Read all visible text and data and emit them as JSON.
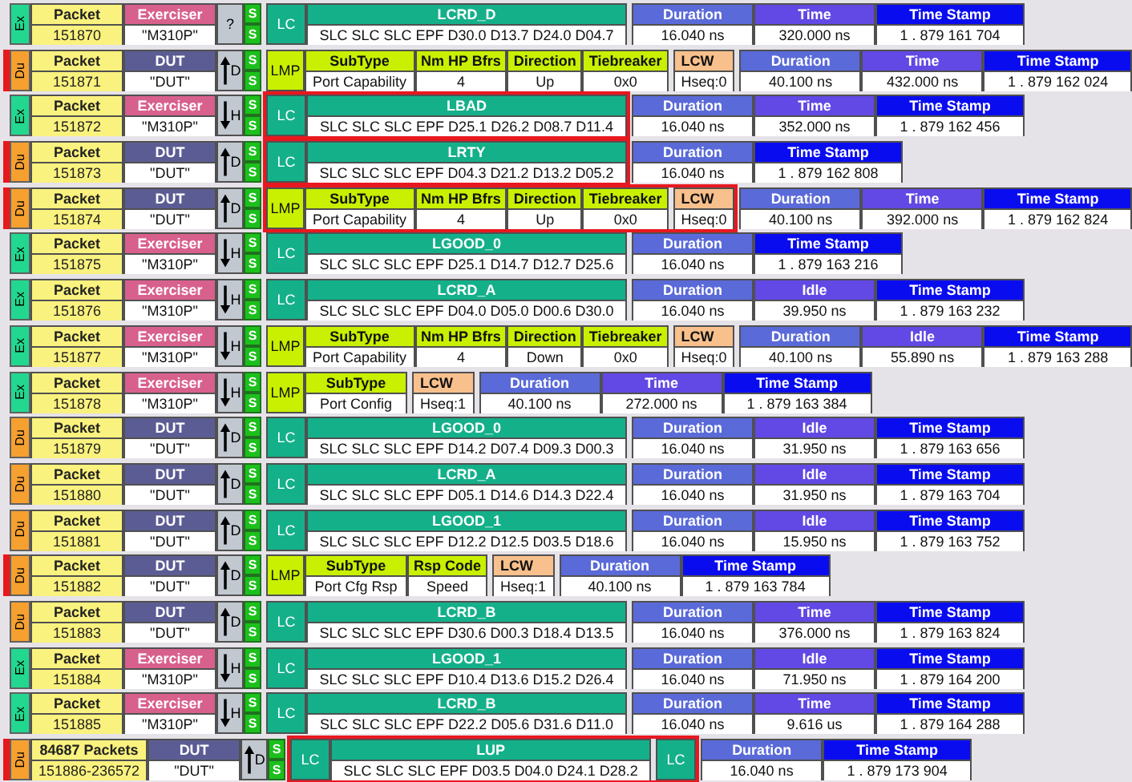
{
  "rows": [
    {
      "side": "Ex",
      "marked": false,
      "packet": {
        "label": "Packet",
        "number": "151870"
      },
      "source": {
        "kind": "exerciser",
        "label": "Exerciser",
        "value": "\"M310P\""
      },
      "arrow_shown": false,
      "link": "?",
      "s": [
        "S",
        "S"
      ],
      "block": {
        "kind": "lc",
        "tag": "LC",
        "name": "LCRD_D",
        "symbols": "SLC SLC SLC EPF D30.0 D13.7 D24.0 D04.7",
        "highlighted": false
      },
      "metrics": [
        {
          "kind": "duration",
          "label": "Duration",
          "value": "16.040 ns"
        },
        {
          "kind": "time",
          "label": "Time",
          "value": "320.000 ns"
        },
        {
          "kind": "timestamp",
          "label": "Time Stamp",
          "value": "1 . 879 161 704"
        }
      ]
    },
    {
      "side": "Du",
      "marked": true,
      "packet": {
        "label": "Packet",
        "number": "151871"
      },
      "source": {
        "kind": "dut",
        "label": "DUT",
        "value": "\"DUT\""
      },
      "arrow_shown": true,
      "upward": true,
      "link": "D",
      "s": [
        "S",
        "S"
      ],
      "block": {
        "kind": "lmp",
        "tag": "LMP",
        "fields": [
          {
            "label": "SubType",
            "value": "Port Capability"
          },
          {
            "label": "Nm HP Bfrs",
            "value": "4"
          },
          {
            "label": "Direction",
            "value": "Up"
          },
          {
            "label": "Tiebreaker",
            "value": "0x0"
          }
        ],
        "lcw": {
          "label": "LCW",
          "value": "Hseq:0"
        },
        "highlighted": false
      },
      "metrics": [
        {
          "kind": "duration",
          "label": "Duration",
          "value": "40.100 ns"
        },
        {
          "kind": "time",
          "label": "Time",
          "value": "432.000 ns"
        },
        {
          "kind": "timestamp",
          "label": "Time Stamp",
          "value": "1 . 879 162 024"
        }
      ]
    },
    {
      "side": "Ex",
      "marked": false,
      "packet": {
        "label": "Packet",
        "number": "151872"
      },
      "source": {
        "kind": "exerciser",
        "label": "Exerciser",
        "value": "\"M310P\""
      },
      "arrow_shown": true,
      "upward": false,
      "link": "H",
      "s": [
        "S",
        "S"
      ],
      "block": {
        "kind": "lc",
        "tag": "LC",
        "name": "LBAD",
        "symbols": "SLC SLC SLC EPF D25.1 D26.2 D08.7 D11.4",
        "highlighted": true
      },
      "metrics": [
        {
          "kind": "duration",
          "label": "Duration",
          "value": "16.040 ns"
        },
        {
          "kind": "time",
          "label": "Time",
          "value": "352.000 ns"
        },
        {
          "kind": "timestamp",
          "label": "Time Stamp",
          "value": "1 . 879 162 456"
        }
      ]
    },
    {
      "side": "Du",
      "marked": true,
      "packet": {
        "label": "Packet",
        "number": "151873"
      },
      "source": {
        "kind": "dut",
        "label": "DUT",
        "value": "\"DUT\""
      },
      "arrow_shown": true,
      "upward": true,
      "link": "D",
      "s": [
        "S",
        "S"
      ],
      "block": {
        "kind": "lc",
        "tag": "LC",
        "name": "LRTY",
        "symbols": "SLC SLC SLC EPF D04.3 D21.2 D13.2 D05.2",
        "highlighted": true
      },
      "metrics": [
        {
          "kind": "duration",
          "label": "Duration",
          "value": "16.040 ns"
        },
        {
          "kind": "timestamp",
          "label": "Time Stamp",
          "value": "1 . 879 162 808"
        }
      ]
    },
    {
      "side": "Du",
      "marked": true,
      "packet": {
        "label": "Packet",
        "number": "151874"
      },
      "source": {
        "kind": "dut",
        "label": "DUT",
        "value": "\"DUT\""
      },
      "arrow_shown": true,
      "upward": true,
      "link": "D",
      "s": [
        "S",
        "S"
      ],
      "block": {
        "kind": "lmp",
        "tag": "LMP",
        "fields": [
          {
            "label": "SubType",
            "value": "Port Capability"
          },
          {
            "label": "Nm HP Bfrs",
            "value": "4"
          },
          {
            "label": "Direction",
            "value": "Up"
          },
          {
            "label": "Tiebreaker",
            "value": "0x0"
          }
        ],
        "lcw": {
          "label": "LCW",
          "value": "Hseq:0"
        },
        "highlighted": true
      },
      "metrics": [
        {
          "kind": "duration",
          "label": "Duration",
          "value": "40.100 ns"
        },
        {
          "kind": "time",
          "label": "Time",
          "value": "392.000 ns"
        },
        {
          "kind": "timestamp",
          "label": "Time Stamp",
          "value": "1 . 879 162 824"
        }
      ]
    },
    {
      "side": "Ex",
      "marked": false,
      "packet": {
        "label": "Packet",
        "number": "151875"
      },
      "source": {
        "kind": "exerciser",
        "label": "Exerciser",
        "value": "\"M310P\""
      },
      "arrow_shown": true,
      "upward": false,
      "link": "H",
      "s": [
        "S",
        "S"
      ],
      "block": {
        "kind": "lc",
        "tag": "LC",
        "name": "LGOOD_0",
        "symbols": "SLC SLC SLC EPF D25.1 D14.7 D12.7 D25.6",
        "highlighted": false
      },
      "metrics": [
        {
          "kind": "duration",
          "label": "Duration",
          "value": "16.040 ns"
        },
        {
          "kind": "timestamp",
          "label": "Time Stamp",
          "value": "1 . 879 163 216"
        }
      ]
    },
    {
      "side": "Ex",
      "marked": false,
      "packet": {
        "label": "Packet",
        "number": "151876"
      },
      "source": {
        "kind": "exerciser",
        "label": "Exerciser",
        "value": "\"M310P\""
      },
      "arrow_shown": true,
      "upward": false,
      "link": "H",
      "s": [
        "S",
        "S"
      ],
      "block": {
        "kind": "lc",
        "tag": "LC",
        "name": "LCRD_A",
        "symbols": "SLC SLC SLC EPF D04.0 D05.0 D00.6 D30.0",
        "highlighted": false
      },
      "metrics": [
        {
          "kind": "duration",
          "label": "Duration",
          "value": "16.040 ns"
        },
        {
          "kind": "time",
          "label": "Idle",
          "value": "39.950 ns"
        },
        {
          "kind": "timestamp",
          "label": "Time Stamp",
          "value": "1 . 879 163 232"
        }
      ]
    },
    {
      "side": "Ex",
      "marked": false,
      "packet": {
        "label": "Packet",
        "number": "151877"
      },
      "source": {
        "kind": "exerciser",
        "label": "Exerciser",
        "value": "\"M310P\""
      },
      "arrow_shown": true,
      "upward": false,
      "link": "H",
      "s": [
        "S",
        "S"
      ],
      "block": {
        "kind": "lmp",
        "tag": "LMP",
        "fields": [
          {
            "label": "SubType",
            "value": "Port Capability"
          },
          {
            "label": "Nm HP Bfrs",
            "value": "4"
          },
          {
            "label": "Direction",
            "value": "Down"
          },
          {
            "label": "Tiebreaker",
            "value": "0x0"
          }
        ],
        "lcw": {
          "label": "LCW",
          "value": "Hseq:0"
        },
        "highlighted": false
      },
      "metrics": [
        {
          "kind": "duration",
          "label": "Duration",
          "value": "40.100 ns"
        },
        {
          "kind": "time",
          "label": "Idle",
          "value": "55.890 ns"
        },
        {
          "kind": "timestamp",
          "label": "Time Stamp",
          "value": "1 . 879 163 288"
        }
      ]
    },
    {
      "side": "Ex",
      "marked": false,
      "packet": {
        "label": "Packet",
        "number": "151878"
      },
      "source": {
        "kind": "exerciser",
        "label": "Exerciser",
        "value": "\"M310P\""
      },
      "arrow_shown": true,
      "upward": false,
      "link": "H",
      "s": [
        "S",
        "S"
      ],
      "block": {
        "kind": "lmp",
        "tag": "LMP",
        "fields": [
          {
            "label": "SubType",
            "value": "Port Config"
          }
        ],
        "lcw": {
          "label": "LCW",
          "value": "Hseq:1"
        },
        "highlighted": false
      },
      "metrics": [
        {
          "kind": "duration",
          "label": "Duration",
          "value": "40.100 ns"
        },
        {
          "kind": "time",
          "label": "Time",
          "value": "272.000 ns"
        },
        {
          "kind": "timestamp",
          "label": "Time Stamp",
          "value": "1 . 879 163 384"
        }
      ]
    },
    {
      "side": "Du",
      "marked": false,
      "packet": {
        "label": "Packet",
        "number": "151879"
      },
      "source": {
        "kind": "dut",
        "label": "DUT",
        "value": "\"DUT\""
      },
      "arrow_shown": true,
      "upward": true,
      "link": "D",
      "s": [
        "S",
        "S"
      ],
      "block": {
        "kind": "lc",
        "tag": "LC",
        "name": "LGOOD_0",
        "symbols": "SLC SLC SLC EPF D14.2 D07.4 D09.3 D00.3",
        "highlighted": false
      },
      "metrics": [
        {
          "kind": "duration",
          "label": "Duration",
          "value": "16.040 ns"
        },
        {
          "kind": "time",
          "label": "Idle",
          "value": "31.950 ns"
        },
        {
          "kind": "timestamp",
          "label": "Time Stamp",
          "value": "1 . 879 163 656"
        }
      ]
    },
    {
      "side": "Du",
      "marked": false,
      "packet": {
        "label": "Packet",
        "number": "151880"
      },
      "source": {
        "kind": "dut",
        "label": "DUT",
        "value": "\"DUT\""
      },
      "arrow_shown": true,
      "upward": true,
      "link": "D",
      "s": [
        "S",
        "S"
      ],
      "block": {
        "kind": "lc",
        "tag": "LC",
        "name": "LCRD_A",
        "symbols": "SLC SLC SLC EPF D05.1 D14.6 D14.3 D22.4",
        "highlighted": false
      },
      "metrics": [
        {
          "kind": "duration",
          "label": "Duration",
          "value": "16.040 ns"
        },
        {
          "kind": "time",
          "label": "Idle",
          "value": "31.950 ns"
        },
        {
          "kind": "timestamp",
          "label": "Time Stamp",
          "value": "1 . 879 163 704"
        }
      ]
    },
    {
      "side": "Du",
      "marked": false,
      "packet": {
        "label": "Packet",
        "number": "151881"
      },
      "source": {
        "kind": "dut",
        "label": "DUT",
        "value": "\"DUT\""
      },
      "arrow_shown": true,
      "upward": true,
      "link": "D",
      "s": [
        "S",
        "S"
      ],
      "block": {
        "kind": "lc",
        "tag": "LC",
        "name": "LGOOD_1",
        "symbols": "SLC SLC SLC EPF D12.2 D12.5 D03.5 D18.6",
        "highlighted": false
      },
      "metrics": [
        {
          "kind": "duration",
          "label": "Duration",
          "value": "16.040 ns"
        },
        {
          "kind": "time",
          "label": "Idle",
          "value": "15.950 ns"
        },
        {
          "kind": "timestamp",
          "label": "Time Stamp",
          "value": "1 . 879 163 752"
        }
      ]
    },
    {
      "side": "Du",
      "marked": true,
      "packet": {
        "label": "Packet",
        "number": "151882"
      },
      "source": {
        "kind": "dut",
        "label": "DUT",
        "value": "\"DUT\""
      },
      "arrow_shown": true,
      "upward": true,
      "link": "D",
      "s": [
        "S",
        "S"
      ],
      "block": {
        "kind": "lmp",
        "tag": "LMP",
        "fields": [
          {
            "label": "SubType",
            "value": "Port Cfg Rsp"
          },
          {
            "label": "Rsp Code",
            "value": "Speed"
          }
        ],
        "lcw": {
          "label": "LCW",
          "value": "Hseq:1"
        },
        "highlighted": false
      },
      "metrics": [
        {
          "kind": "duration",
          "label": "Duration",
          "value": "40.100 ns"
        },
        {
          "kind": "timestamp",
          "label": "Time Stamp",
          "value": "1 . 879 163 784"
        }
      ]
    },
    {
      "side": "Du",
      "marked": false,
      "packet": {
        "label": "Packet",
        "number": "151883"
      },
      "source": {
        "kind": "dut",
        "label": "DUT",
        "value": "\"DUT\""
      },
      "arrow_shown": true,
      "upward": true,
      "link": "D",
      "s": [
        "S",
        "S"
      ],
      "block": {
        "kind": "lc",
        "tag": "LC",
        "name": "LCRD_B",
        "symbols": "SLC SLC SLC EPF D30.6 D00.3 D18.4 D13.5",
        "highlighted": false
      },
      "metrics": [
        {
          "kind": "duration",
          "label": "Duration",
          "value": "16.040 ns"
        },
        {
          "kind": "time",
          "label": "Time",
          "value": "376.000 ns"
        },
        {
          "kind": "timestamp",
          "label": "Time Stamp",
          "value": "1 . 879 163 824"
        }
      ]
    },
    {
      "side": "Ex",
      "marked": false,
      "packet": {
        "label": "Packet",
        "number": "151884"
      },
      "source": {
        "kind": "exerciser",
        "label": "Exerciser",
        "value": "\"M310P\""
      },
      "arrow_shown": true,
      "upward": false,
      "link": "H",
      "s": [
        "S",
        "S"
      ],
      "block": {
        "kind": "lc",
        "tag": "LC",
        "name": "LGOOD_1",
        "symbols": "SLC SLC SLC EPF D10.4 D13.6 D15.2 D26.4",
        "highlighted": false
      },
      "metrics": [
        {
          "kind": "duration",
          "label": "Duration",
          "value": "16.040 ns"
        },
        {
          "kind": "time",
          "label": "Idle",
          "value": "71.950 ns"
        },
        {
          "kind": "timestamp",
          "label": "Time Stamp",
          "value": "1 . 879 164 200"
        }
      ]
    },
    {
      "side": "Ex",
      "marked": false,
      "packet": {
        "label": "Packet",
        "number": "151885"
      },
      "source": {
        "kind": "exerciser",
        "label": "Exerciser",
        "value": "\"M310P\""
      },
      "arrow_shown": true,
      "upward": false,
      "link": "H",
      "s": [
        "S",
        "S"
      ],
      "block": {
        "kind": "lc",
        "tag": "LC",
        "name": "LCRD_B",
        "symbols": "SLC SLC SLC EPF D22.2 D05.6 D31.6 D11.0",
        "highlighted": false
      },
      "metrics": [
        {
          "kind": "duration",
          "label": "Duration",
          "value": "16.040 ns"
        },
        {
          "kind": "time",
          "label": "Time",
          "value": "9.616 us"
        },
        {
          "kind": "timestamp",
          "label": "Time Stamp",
          "value": "1 . 879 164 288"
        }
      ]
    },
    {
      "side": "Du",
      "marked": true,
      "packet": {
        "label": "84687 Packets",
        "number": "151886-236572"
      },
      "source": {
        "kind": "dut",
        "label": "DUT",
        "value": "\"DUT\""
      },
      "arrow_shown": true,
      "upward": true,
      "link": "D",
      "s": [
        "S",
        "S"
      ],
      "block": {
        "kind": "lc",
        "tag": "LC",
        "name": "LUP",
        "symbols": "SLC SLC SLC EPF D03.5 D04.0 D24.1 D28.2",
        "trailing_tag": "LC",
        "highlighted": true
      },
      "metrics": [
        {
          "kind": "duration",
          "label": "Duration",
          "value": "16.040 ns"
        },
        {
          "kind": "timestamp",
          "label": "Time Stamp",
          "value": "1 . 879 173 904"
        }
      ]
    }
  ]
}
